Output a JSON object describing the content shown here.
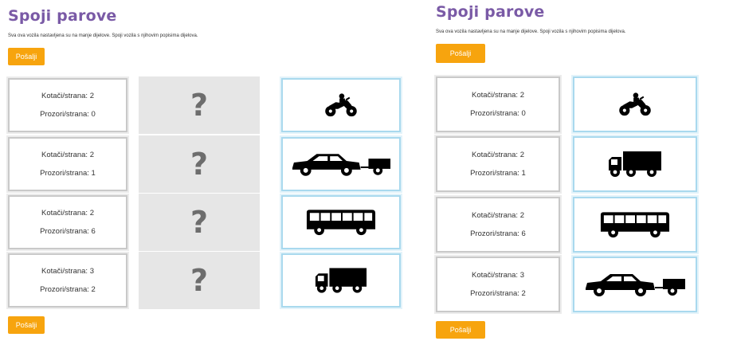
{
  "left": {
    "title": "Spoji parove",
    "instructions": "Sva ova vozila nastavljena su na manje dijelove. Spoji vozila s njihovim popisima dijelova.",
    "submit_top": "Pošalji",
    "submit_bottom": "Pošalji",
    "cards": [
      {
        "wheels": "Kotači/strana: 2",
        "windows": "Prozori/strana: 0"
      },
      {
        "wheels": "Kotači/strana: 2",
        "windows": "Prozori/strana: 1"
      },
      {
        "wheels": "Kotači/strana: 2",
        "windows": "Prozori/strana: 6"
      },
      {
        "wheels": "Kotači/strana: 3",
        "windows": "Prozori/strana: 2"
      }
    ],
    "slots": [
      "?",
      "?",
      "?",
      "?"
    ],
    "vehicles": [
      "motorcycle-icon",
      "car-with-trailer-icon",
      "bus-icon",
      "truck-icon"
    ]
  },
  "right": {
    "title": "Spoji parove",
    "instructions": "Sva ova vozila nastavljena su na manje dijelove. Spoji vozila s njihovim popisima dijelova.",
    "submit_top": "Pošalji",
    "submit_bottom": "Pošalji",
    "cards": [
      {
        "wheels": "Kotači/strana: 2",
        "windows": "Prozori/strana: 0"
      },
      {
        "wheels": "Kotači/strana: 2",
        "windows": "Prozori/strana: 1"
      },
      {
        "wheels": "Kotači/strana: 2",
        "windows": "Prozori/strana: 6"
      },
      {
        "wheels": "Kotači/strana: 3",
        "windows": "Prozori/strana: 2"
      }
    ],
    "vehicles": [
      "motorcycle-icon",
      "truck-icon",
      "bus-icon",
      "car-with-trailer-icon"
    ]
  },
  "colors": {
    "title": "#7a5aa6",
    "button": "#f7a40e",
    "card_border": "#c9c9c9",
    "vehicle_border": "#a9d9ee",
    "slot_bg": "#e6e6e6"
  }
}
